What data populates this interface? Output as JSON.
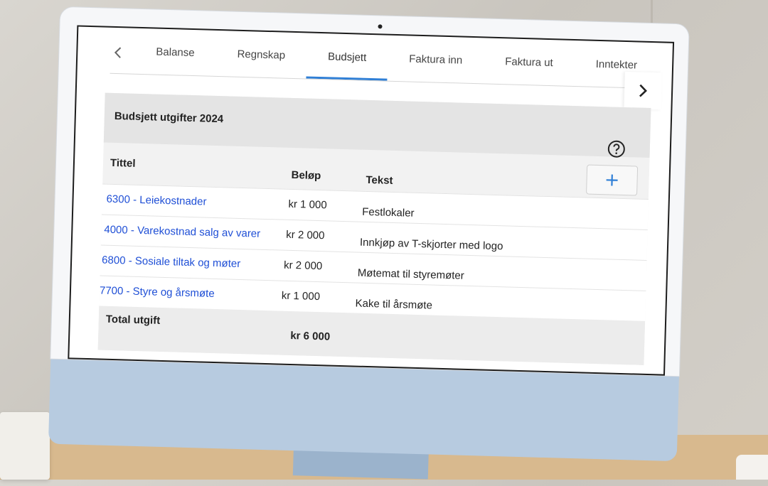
{
  "tabs": {
    "items": [
      {
        "label": "Balanse"
      },
      {
        "label": "Regnskap"
      },
      {
        "label": "Budsjett"
      },
      {
        "label": "Faktura inn"
      },
      {
        "label": "Faktura ut"
      },
      {
        "label": "Inntekter"
      }
    ],
    "active_index": 2,
    "back_icon": "chevron-left-icon",
    "next_icon": "chevron-right-icon"
  },
  "budget": {
    "title": "Budsjett utgifter 2024",
    "help_icon": "help-circle-icon",
    "add_icon": "plus-icon",
    "columns": {
      "title": "Tittel",
      "amount": "Beløp",
      "text": "Tekst"
    },
    "rows": [
      {
        "title": "6300 - Leiekostnader",
        "amount": "kr 1 000",
        "text": "Festlokaler"
      },
      {
        "title": "4000 - Varekostnad salg av varer",
        "amount": "kr 2 000",
        "text": "Innkjøp av T-skjorter med logo"
      },
      {
        "title": "6800 - Sosiale tiltak og møter",
        "amount": "kr 2 000",
        "text": "Møtemat til styremøter"
      },
      {
        "title": "7700 - Styre og årsmøte",
        "amount": "kr 1 000",
        "text": "Kake til årsmøte"
      }
    ],
    "total": {
      "label": "Total utgift",
      "amount": "kr 6 000"
    }
  },
  "colors": {
    "accent": "#2f7fd6",
    "link": "#1f4fd6",
    "device_chin": "#b7cbe0"
  }
}
